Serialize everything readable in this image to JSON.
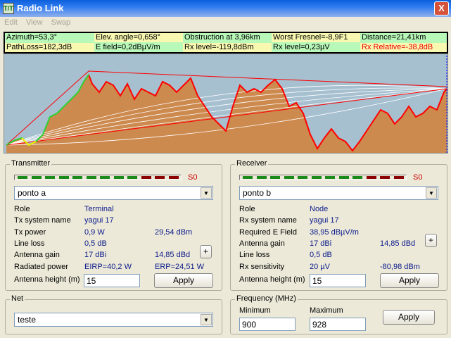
{
  "window": {
    "title": "Radio Link",
    "close": "X",
    "icon_text": "T/T"
  },
  "menu": [
    "Edit",
    "View",
    "Swap"
  ],
  "info": {
    "row1": [
      "Azimuth=53,3°",
      "Elev. angle=0,658°",
      "Obstruction at 3,96km",
      "Worst Fresnel=-8,9F1",
      "Distance=21,41km"
    ],
    "row2": [
      "PathLoss=182,3dB",
      "E field=0,2dBµV/m",
      "Rx level=-119,8dBm",
      "Rx level=0,23µV",
      "Rx Relative=-38,8dB"
    ]
  },
  "colors": {
    "terrain": "#cd8a4f",
    "sky": "#a6c0d0",
    "los": "#ff0000",
    "green": "#00a000",
    "dark_red": "#800000"
  },
  "transmitter": {
    "title": "Transmitter",
    "meter_label": "S0",
    "site": "ponto a",
    "rows": [
      {
        "label": "Role",
        "v1": "Terminal"
      },
      {
        "label": "Tx system name",
        "v1": "yagui 17"
      },
      {
        "label": "Tx power",
        "v1": "0,9 W",
        "v2": "29,54 dBm"
      },
      {
        "label": "Line loss",
        "v1": "0,5 dB"
      },
      {
        "label": "Antenna gain",
        "v1": "17 dBi",
        "v2": "14,85 dBd"
      },
      {
        "label": "Radiated power",
        "v1": "EIRP=40,2 W",
        "v2": "ERP=24,51 W"
      }
    ],
    "height_label": "Antenna height (m)",
    "height": "15",
    "apply": "Apply",
    "plus": "+"
  },
  "receiver": {
    "title": "Receiver",
    "meter_label": "S0",
    "site": "ponto b",
    "rows": [
      {
        "label": "Role",
        "v1": "Node"
      },
      {
        "label": "Rx system name",
        "v1": "yagui 17"
      },
      {
        "label": "Required E Field",
        "v1": "38,95 dBµV/m"
      },
      {
        "label": "Antenna gain",
        "v1": "17 dBi",
        "v2": "14,85 dBd"
      },
      {
        "label": "Line loss",
        "v1": "0,5 dB"
      },
      {
        "label": "Rx sensitivity",
        "v1": "20 µV",
        "v2": "-80,98 dBm"
      }
    ],
    "height_label": "Antenna height (m)",
    "height": "15",
    "apply": "Apply",
    "plus": "+"
  },
  "net": {
    "title": "Net",
    "value": "teste"
  },
  "frequency": {
    "title": "Frequency (MHz)",
    "min_label": "Minimum",
    "max_label": "Maximum",
    "min": "900",
    "max": "928",
    "apply": "Apply"
  }
}
